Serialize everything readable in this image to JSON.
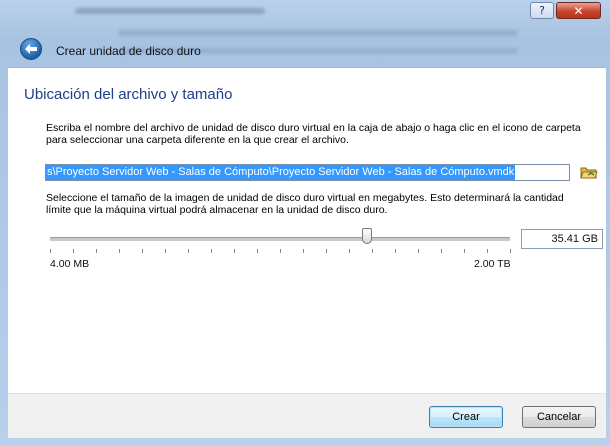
{
  "window": {
    "help_label": "?",
    "close_label": "✕"
  },
  "wizard": {
    "title": "Crear unidad de disco duro",
    "back_icon": "back-arrow-icon"
  },
  "page": {
    "heading": "Ubicación del archivo y tamaño",
    "file_description": "Escriba el nombre del archivo de unidad de disco duro virtual en la caja de abajo o haga clic en el icono de carpeta para seleccionar una carpeta diferente en la que crear el archivo.",
    "file_path": "s\\Proyecto Servidor Web - Salas de Cómputo\\Proyecto Servidor Web - Salas de Cómputo.vmdk",
    "folder_icon": "folder-browse-icon",
    "size_description": "Seleccione el tamaño de la imagen de unidad de disco duro virtual en megabytes. Esto determinará la cantidad límite que la máquina virtual podrá almacenar en la unidad de disco duro.",
    "size_value": "35.41 GB",
    "slider_position": 0.69,
    "scale_min": "4.00 MB",
    "scale_max": "2.00 TB"
  },
  "buttons": {
    "create": "Crear",
    "cancel": "Cancelar"
  },
  "colors": {
    "heading": "#1e3f8a",
    "selection": "#3399ff",
    "frame": "#b9d1ea"
  }
}
